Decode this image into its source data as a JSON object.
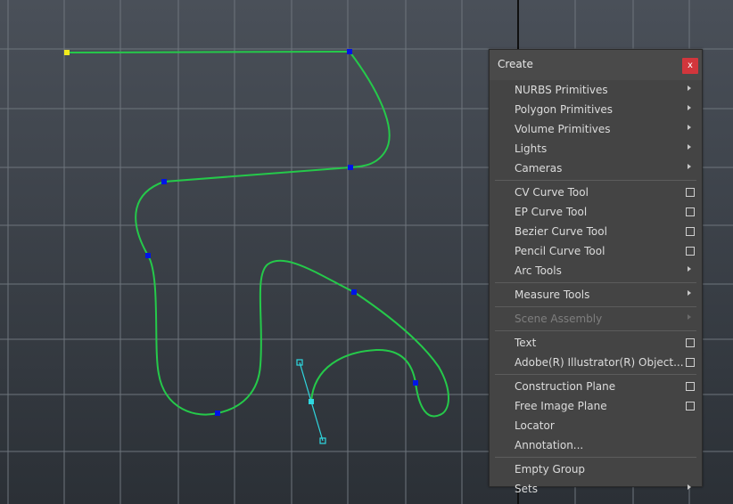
{
  "colors": {
    "viewport_top": "#4a5059",
    "viewport_bottom": "#2b3036",
    "grid_line": "#6e757d",
    "axis_line": "#101010",
    "curve": "#25c94a",
    "cv_marker": "#0015e6",
    "start_marker": "#f2ea1c",
    "tangent": "#2fd8e0"
  },
  "menu": {
    "title": "Create",
    "close_label": "x",
    "groups": [
      [
        {
          "label": "NURBS Primitives",
          "type": "submenu",
          "enabled": true
        },
        {
          "label": "Polygon Primitives",
          "type": "submenu",
          "enabled": true
        },
        {
          "label": "Volume Primitives",
          "type": "submenu",
          "enabled": true
        },
        {
          "label": "Lights",
          "type": "submenu",
          "enabled": true
        },
        {
          "label": "Cameras",
          "type": "submenu",
          "enabled": true
        }
      ],
      [
        {
          "label": "CV Curve Tool",
          "type": "option",
          "enabled": true
        },
        {
          "label": "EP Curve Tool",
          "type": "option",
          "enabled": true
        },
        {
          "label": "Bezier Curve Tool",
          "type": "option",
          "enabled": true
        },
        {
          "label": "Pencil Curve Tool",
          "type": "option",
          "enabled": true
        },
        {
          "label": "Arc Tools",
          "type": "submenu",
          "enabled": true
        }
      ],
      [
        {
          "label": "Measure Tools",
          "type": "submenu",
          "enabled": true
        }
      ],
      [
        {
          "label": "Scene Assembly",
          "type": "submenu",
          "enabled": false
        }
      ],
      [
        {
          "label": "Text",
          "type": "option",
          "enabled": true
        },
        {
          "label": "Adobe(R) Illustrator(R) Object...",
          "type": "option",
          "enabled": true
        }
      ],
      [
        {
          "label": "Construction Plane",
          "type": "option",
          "enabled": true
        },
        {
          "label": "Free Image Plane",
          "type": "option",
          "enabled": true
        },
        {
          "label": "Locator",
          "type": "plain",
          "enabled": true
        },
        {
          "label": "Annotation...",
          "type": "plain",
          "enabled": true
        }
      ],
      [
        {
          "label": "Empty Group",
          "type": "plain",
          "enabled": true
        },
        {
          "label": "Sets",
          "type": "submenu",
          "enabled": true
        }
      ]
    ]
  }
}
